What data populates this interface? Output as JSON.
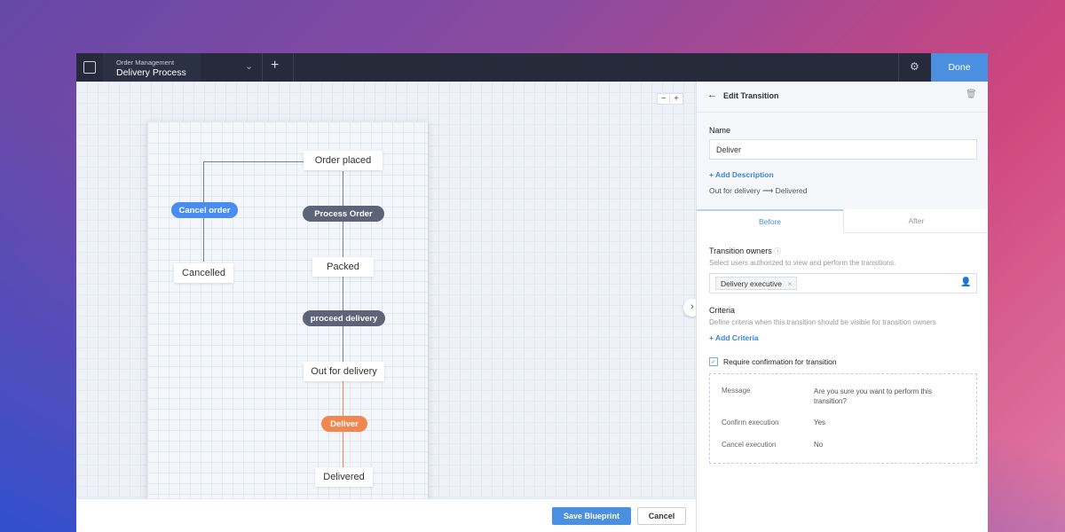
{
  "header": {
    "app_icon": "workflow-icon",
    "subtitle": "Order Management",
    "title": "Delivery Process",
    "dropdown_icon": "chevron-down-icon",
    "add_icon": "plus-icon",
    "settings_icon": "gear-icon",
    "done_label": "Done"
  },
  "canvas": {
    "zoom_out": "−",
    "zoom_in": "+",
    "states": [
      "Order placed",
      "Cancelled",
      "Packed",
      "Out for delivery",
      "Delivered"
    ],
    "transitions": [
      "Cancel order",
      "Process Order",
      "proceed delivery",
      "Deliver"
    ],
    "colors": {
      "cancel": "#4a8df0",
      "default": "#5f6377",
      "active": "#f0874f"
    },
    "expand_icon": "chevron-right-icon"
  },
  "footer": {
    "save_label": "Save Blueprint",
    "cancel_label": "Cancel"
  },
  "panel": {
    "back_icon": "arrow-left-icon",
    "title": "Edit Transition",
    "delete_icon": "trash-icon",
    "name_label": "Name",
    "name_value": "Deliver",
    "add_description": "+ Add Description",
    "from": "Out for delivery",
    "arrow": "⟶",
    "to": "Delivered",
    "tabs": [
      "Before",
      "After"
    ],
    "owners_label": "Transition owners",
    "owners_help": "Select users authorized to view and  perform the transitions.",
    "owner_chip": "Delivery executive",
    "chip_remove": "×",
    "add_user_icon": "add-user-icon",
    "criteria_label": "Criteria",
    "criteria_help": "Define criteria when this transition should be visible for transition owners",
    "add_criteria": "+ Add Criteria",
    "confirm_label": "Require confirmation for transition",
    "confirm_checked": true,
    "confirm_rows": [
      {
        "key": "Message",
        "value": "Are you sure you want to perform this transition?"
      },
      {
        "key": "Confirm execution",
        "value": "Yes"
      },
      {
        "key": "Cancel execution",
        "value": "No"
      }
    ]
  }
}
